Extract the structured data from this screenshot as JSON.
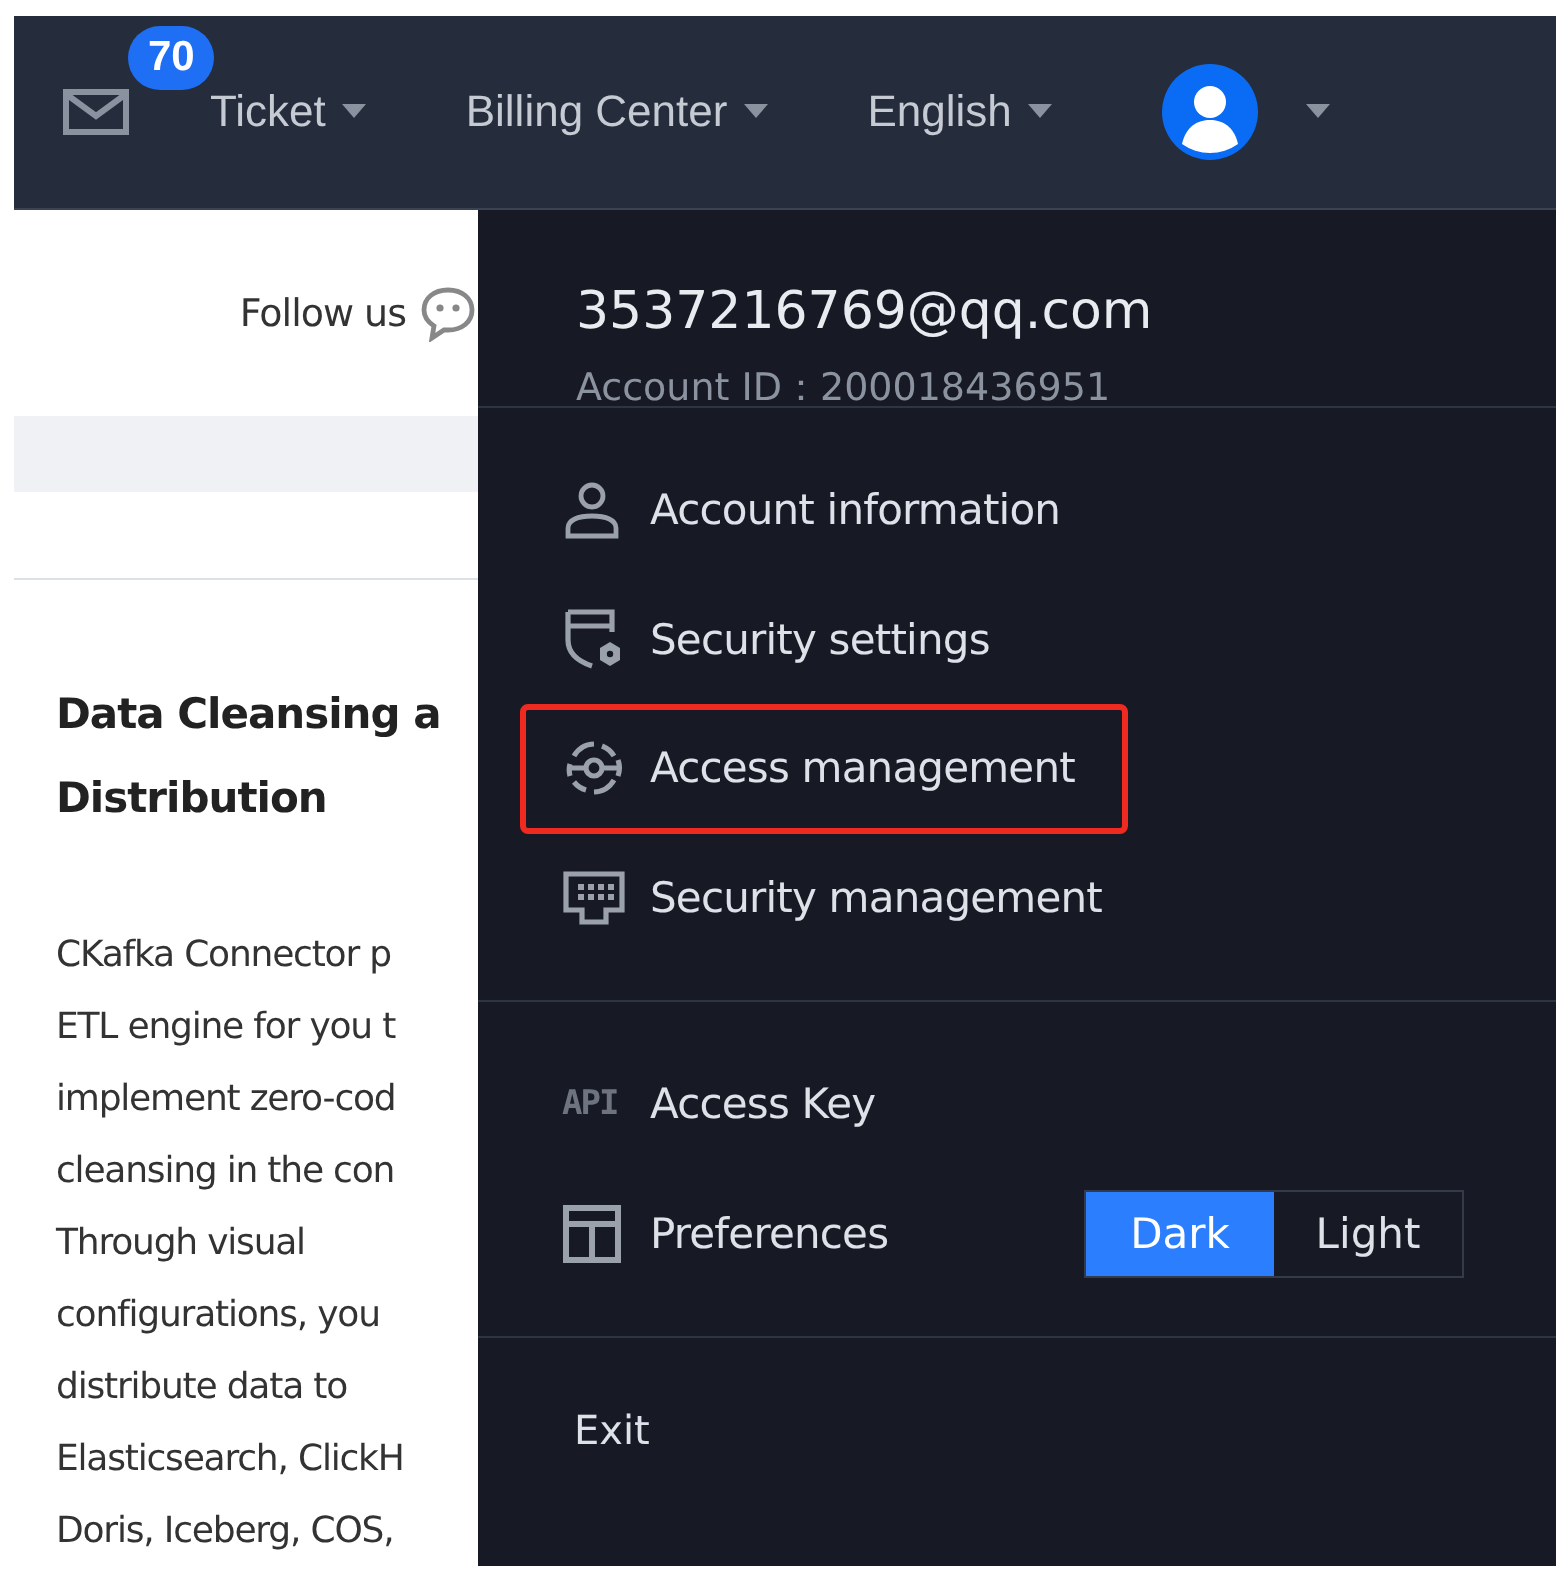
{
  "top_bar": {
    "mail_badge": "70",
    "menus": [
      {
        "label": "Ticket"
      },
      {
        "label": "Billing Center"
      },
      {
        "label": "English"
      }
    ]
  },
  "page": {
    "follow_us": "Follow us",
    "heading": [
      "Data Cleansing a",
      "Distribution"
    ],
    "paragraph_lines": [
      "CKafka Connector p",
      "ETL engine for you t",
      "implement zero-cod",
      "cleansing in the con",
      "Through visual",
      "configurations, you",
      "distribute data to",
      "Elasticsearch, ClickH",
      "Doris, Iceberg, COS,"
    ]
  },
  "account_menu": {
    "email": "3537216769@qq.com",
    "account_id": "Account ID：200018436951",
    "groups": [
      [
        {
          "kind": "person",
          "label": "Account information",
          "highlighted": false
        },
        {
          "kind": "shield",
          "label": "Security settings",
          "highlighted": false
        },
        {
          "kind": "access",
          "label": "Access management",
          "highlighted": true
        },
        {
          "kind": "keyboard",
          "label": "Security management",
          "highlighted": false
        }
      ],
      [
        {
          "kind": "api",
          "icon_text": "API",
          "label": "Access Key",
          "highlighted": false
        },
        {
          "kind": "layout",
          "label": "Preferences",
          "highlighted": false,
          "options": [
            {
              "label": "Dark",
              "selected": true
            },
            {
              "label": "Light",
              "selected": false
            }
          ]
        }
      ]
    ],
    "exit": "Exit"
  }
}
